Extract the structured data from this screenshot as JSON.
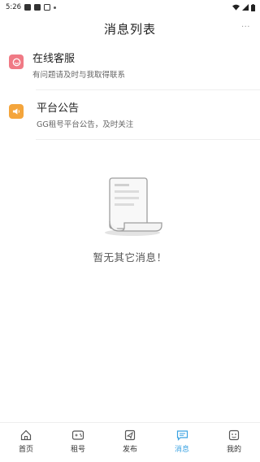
{
  "status_bar": {
    "time": "5:26"
  },
  "header": {
    "title": "消息列表",
    "more_label": "···"
  },
  "messages": [
    {
      "name": "在线客服",
      "desc": "有问题请及时与我取得联系"
    },
    {
      "name": "平台公告",
      "desc": "GG租号平台公告，及时关注"
    }
  ],
  "empty": {
    "message": "暂无其它消息！"
  },
  "tabs": [
    {
      "label": "首页"
    },
    {
      "label": "租号"
    },
    {
      "label": "发布"
    },
    {
      "label": "消息"
    },
    {
      "label": "我的"
    }
  ],
  "colors": {
    "accent": "#3aa2e2",
    "service_icon": "#f07a85",
    "notice_icon": "#f4a53c"
  }
}
